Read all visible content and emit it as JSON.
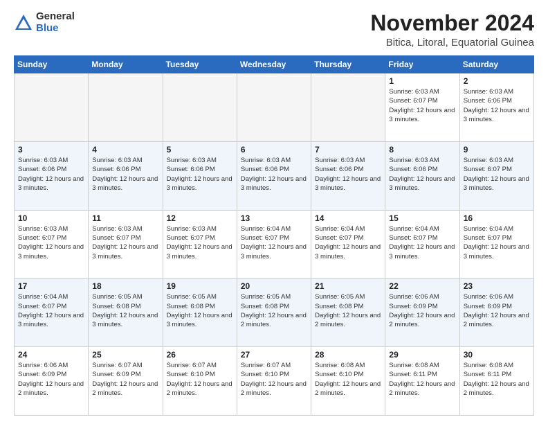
{
  "logo": {
    "general": "General",
    "blue": "Blue"
  },
  "header": {
    "title": "November 2024",
    "subtitle": "Bitica, Litoral, Equatorial Guinea"
  },
  "weekdays": [
    "Sunday",
    "Monday",
    "Tuesday",
    "Wednesday",
    "Thursday",
    "Friday",
    "Saturday"
  ],
  "weeks": [
    [
      {
        "day": "",
        "info": ""
      },
      {
        "day": "",
        "info": ""
      },
      {
        "day": "",
        "info": ""
      },
      {
        "day": "",
        "info": ""
      },
      {
        "day": "",
        "info": ""
      },
      {
        "day": "1",
        "info": "Sunrise: 6:03 AM\nSunset: 6:07 PM\nDaylight: 12 hours and 3 minutes."
      },
      {
        "day": "2",
        "info": "Sunrise: 6:03 AM\nSunset: 6:06 PM\nDaylight: 12 hours and 3 minutes."
      }
    ],
    [
      {
        "day": "3",
        "info": "Sunrise: 6:03 AM\nSunset: 6:06 PM\nDaylight: 12 hours and 3 minutes."
      },
      {
        "day": "4",
        "info": "Sunrise: 6:03 AM\nSunset: 6:06 PM\nDaylight: 12 hours and 3 minutes."
      },
      {
        "day": "5",
        "info": "Sunrise: 6:03 AM\nSunset: 6:06 PM\nDaylight: 12 hours and 3 minutes."
      },
      {
        "day": "6",
        "info": "Sunrise: 6:03 AM\nSunset: 6:06 PM\nDaylight: 12 hours and 3 minutes."
      },
      {
        "day": "7",
        "info": "Sunrise: 6:03 AM\nSunset: 6:06 PM\nDaylight: 12 hours and 3 minutes."
      },
      {
        "day": "8",
        "info": "Sunrise: 6:03 AM\nSunset: 6:06 PM\nDaylight: 12 hours and 3 minutes."
      },
      {
        "day": "9",
        "info": "Sunrise: 6:03 AM\nSunset: 6:07 PM\nDaylight: 12 hours and 3 minutes."
      }
    ],
    [
      {
        "day": "10",
        "info": "Sunrise: 6:03 AM\nSunset: 6:07 PM\nDaylight: 12 hours and 3 minutes."
      },
      {
        "day": "11",
        "info": "Sunrise: 6:03 AM\nSunset: 6:07 PM\nDaylight: 12 hours and 3 minutes."
      },
      {
        "day": "12",
        "info": "Sunrise: 6:03 AM\nSunset: 6:07 PM\nDaylight: 12 hours and 3 minutes."
      },
      {
        "day": "13",
        "info": "Sunrise: 6:04 AM\nSunset: 6:07 PM\nDaylight: 12 hours and 3 minutes."
      },
      {
        "day": "14",
        "info": "Sunrise: 6:04 AM\nSunset: 6:07 PM\nDaylight: 12 hours and 3 minutes."
      },
      {
        "day": "15",
        "info": "Sunrise: 6:04 AM\nSunset: 6:07 PM\nDaylight: 12 hours and 3 minutes."
      },
      {
        "day": "16",
        "info": "Sunrise: 6:04 AM\nSunset: 6:07 PM\nDaylight: 12 hours and 3 minutes."
      }
    ],
    [
      {
        "day": "17",
        "info": "Sunrise: 6:04 AM\nSunset: 6:07 PM\nDaylight: 12 hours and 3 minutes."
      },
      {
        "day": "18",
        "info": "Sunrise: 6:05 AM\nSunset: 6:08 PM\nDaylight: 12 hours and 3 minutes."
      },
      {
        "day": "19",
        "info": "Sunrise: 6:05 AM\nSunset: 6:08 PM\nDaylight: 12 hours and 3 minutes."
      },
      {
        "day": "20",
        "info": "Sunrise: 6:05 AM\nSunset: 6:08 PM\nDaylight: 12 hours and 2 minutes."
      },
      {
        "day": "21",
        "info": "Sunrise: 6:05 AM\nSunset: 6:08 PM\nDaylight: 12 hours and 2 minutes."
      },
      {
        "day": "22",
        "info": "Sunrise: 6:06 AM\nSunset: 6:09 PM\nDaylight: 12 hours and 2 minutes."
      },
      {
        "day": "23",
        "info": "Sunrise: 6:06 AM\nSunset: 6:09 PM\nDaylight: 12 hours and 2 minutes."
      }
    ],
    [
      {
        "day": "24",
        "info": "Sunrise: 6:06 AM\nSunset: 6:09 PM\nDaylight: 12 hours and 2 minutes."
      },
      {
        "day": "25",
        "info": "Sunrise: 6:07 AM\nSunset: 6:09 PM\nDaylight: 12 hours and 2 minutes."
      },
      {
        "day": "26",
        "info": "Sunrise: 6:07 AM\nSunset: 6:10 PM\nDaylight: 12 hours and 2 minutes."
      },
      {
        "day": "27",
        "info": "Sunrise: 6:07 AM\nSunset: 6:10 PM\nDaylight: 12 hours and 2 minutes."
      },
      {
        "day": "28",
        "info": "Sunrise: 6:08 AM\nSunset: 6:10 PM\nDaylight: 12 hours and 2 minutes."
      },
      {
        "day": "29",
        "info": "Sunrise: 6:08 AM\nSunset: 6:11 PM\nDaylight: 12 hours and 2 minutes."
      },
      {
        "day": "30",
        "info": "Sunrise: 6:08 AM\nSunset: 6:11 PM\nDaylight: 12 hours and 2 minutes."
      }
    ]
  ]
}
